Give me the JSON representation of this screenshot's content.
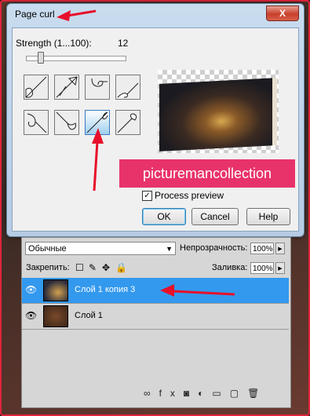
{
  "dialog": {
    "title": "Page curl",
    "close_glyph": "X",
    "strength_label": "Strength (1...100):",
    "strength_value": "12",
    "process_preview_label": "Process preview",
    "process_preview_checked": true,
    "ok_label": "OK",
    "cancel_label": "Cancel",
    "help_label": "Help",
    "selected_curl_index": 6
  },
  "watermark": "picturemancollection",
  "layers_panel": {
    "blend_mode": "Обычные",
    "opacity_label": "Непрозрачность:",
    "opacity_value": "100%",
    "lock_label": "Закрепить:",
    "fill_label": "Заливка:",
    "fill_value": "100%",
    "layers": [
      {
        "name": "Слой 1 копия 3",
        "active": true
      },
      {
        "name": "Слой 1",
        "active": false
      }
    ]
  },
  "colors": {
    "annotation_arrow": "#e8102a",
    "watermark_bg": "#e8336a",
    "active_layer": "#3399ee"
  }
}
